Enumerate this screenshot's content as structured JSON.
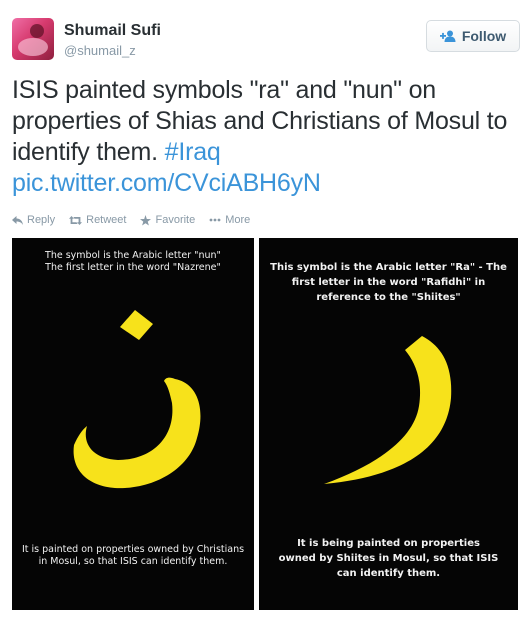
{
  "user": {
    "display_name": "Shumail Sufi",
    "handle": "@shumail_z"
  },
  "follow_button": {
    "label": "Follow",
    "icon": "add-user-icon"
  },
  "tweet": {
    "text_main": "ISIS painted symbols  \"ra\" and \"nun\" on properties of Shias and Christians of Mosul to identify them. ",
    "hashtag": "#Iraq",
    "link": "pic.twitter.com/CVciABH6yN"
  },
  "actions": [
    {
      "label": "Reply",
      "icon": "reply-icon"
    },
    {
      "label": "Retweet",
      "icon": "retweet-icon"
    },
    {
      "label": "Favorite",
      "icon": "star-icon"
    },
    {
      "label": "More",
      "icon": "more-icon"
    }
  ],
  "media": {
    "left": {
      "caption_top_1": "The symbol is the Arabic letter \"nun\"",
      "caption_top_2": "The first letter in the word \"Nazrene\"",
      "caption_bottom_1": "It is painted on properties owned by Christians",
      "caption_bottom_2": "in Mosul, so that ISIS can identify them.",
      "glyph_color": "#f7e21b"
    },
    "right": {
      "caption_top_1": "This symbol is the Arabic letter \"Ra\" - The",
      "caption_top_2": "first letter in the word \"Rafidhi\" in",
      "caption_top_3": "reference to the \"Shiites\"",
      "caption_bottom_1": "It is being painted on properties",
      "caption_bottom_2": "owned by Shiites in Mosul, so that ISIS",
      "caption_bottom_3": "can identify them.",
      "glyph_color": "#f7e21b"
    }
  },
  "colors": {
    "link": "#3b94d9",
    "text": "#292f33",
    "muted": "#8899a6",
    "panel_bg": "#050505"
  }
}
